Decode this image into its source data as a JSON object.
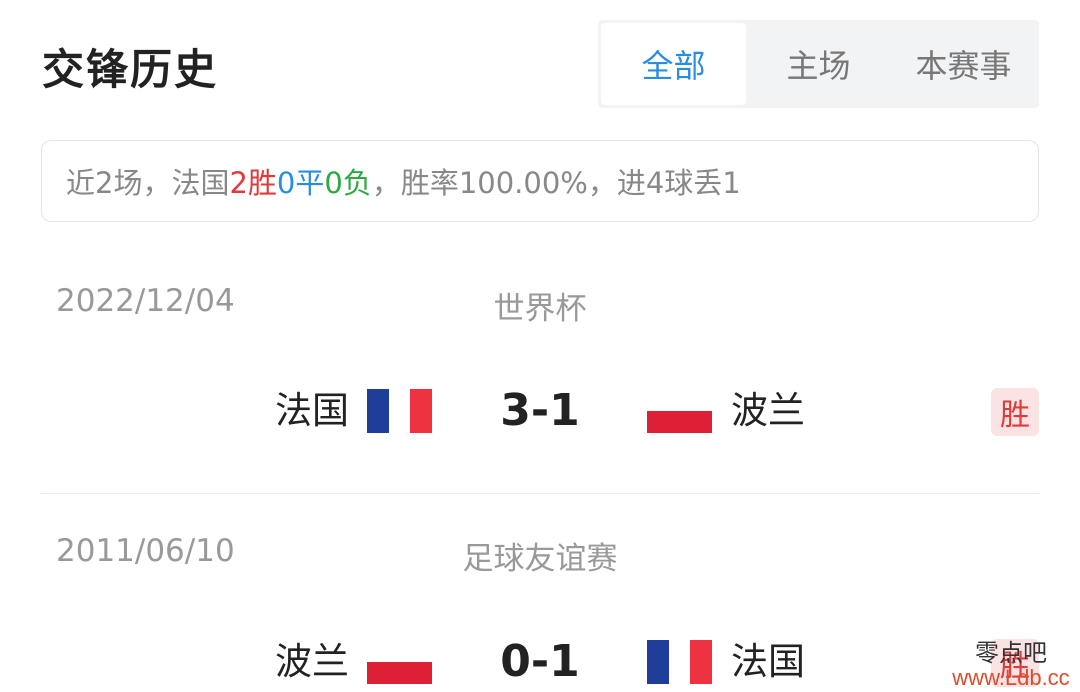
{
  "header": {
    "title": "交锋历史"
  },
  "tabs": [
    {
      "label": "全部",
      "active": true
    },
    {
      "label": "主场",
      "active": false
    },
    {
      "label": "本赛事",
      "active": false
    }
  ],
  "summary": {
    "prefix": "近2场，法国",
    "wins": "2胜",
    "draws": "0平",
    "losses": "0负",
    "suffix": "，胜率100.00%，进4球丢1"
  },
  "colors": {
    "accent": "#2a8ee0",
    "win": "#e03a3a",
    "draw": "#2a8ee0",
    "loss": "#2bab3f",
    "france_flag": [
      "#1f3e9a",
      "#ffffff",
      "#ee3340"
    ],
    "poland_flag": [
      "#ffffff",
      "#dd2035"
    ]
  },
  "matches": [
    {
      "date": "2022/12/04",
      "competition": "世界杯",
      "home": "法国",
      "home_flag": "france-flag-icon",
      "score": "3-1",
      "away": "波兰",
      "away_flag": "poland-flag-icon",
      "result": "胜"
    },
    {
      "date": "2011/06/10",
      "competition": "足球友谊赛",
      "home": "波兰",
      "home_flag": "poland-flag-icon",
      "score": "0-1",
      "away": "法国",
      "away_flag": "france-flag-icon",
      "result": "胜"
    }
  ],
  "watermark": {
    "text": "零点吧",
    "url": "www.Ldb.cc"
  }
}
